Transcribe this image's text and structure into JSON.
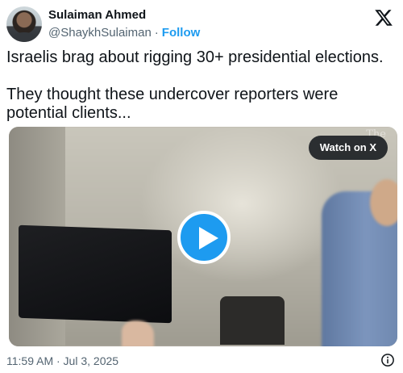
{
  "author": {
    "display_name": "Sulaiman Ahmed",
    "handle": "@ShaykhSulaiman",
    "separator": "·",
    "follow_label": "Follow"
  },
  "icons": {
    "brand": "x-logo-icon",
    "info": "info-icon",
    "play": "play-icon"
  },
  "tweet": {
    "paragraphs": [
      "Israelis brag about rigging 30+ presidential elections.",
      "They thought these undercover reporters were potential clients..."
    ]
  },
  "media": {
    "watch_label": "Watch on X",
    "watermark": "The"
  },
  "footer": {
    "timestamp": "11:59 AM · Jul 3, 2025"
  },
  "colors": {
    "accent": "#1d9bf0",
    "text": "#0f1419",
    "secondary": "#536471"
  }
}
